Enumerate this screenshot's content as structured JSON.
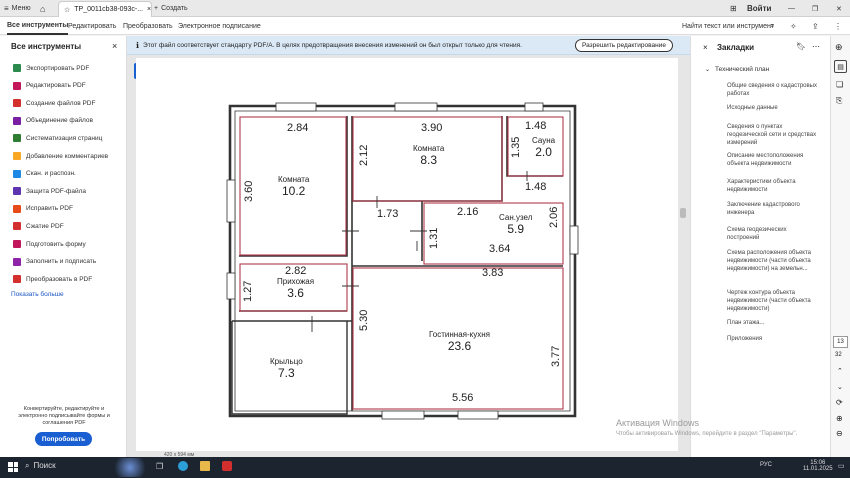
{
  "window": {
    "menu_label": "Меню",
    "tab_title": "TP_0011cb38-093c-...",
    "new_tab_label": "Создать",
    "signin_label": "Войти"
  },
  "menubar": {
    "all_tools": "Все инструменты",
    "edit": "Редактировать",
    "convert": "Преобразовать",
    "esign": "Электронное подписание",
    "search_label": "Найти текст или инструмент"
  },
  "left_panel": {
    "title": "Все инструменты",
    "tools": [
      {
        "label": "Экспортировать PDF",
        "color": "#2d8a4e"
      },
      {
        "label": "Редактировать PDF",
        "color": "#c2185b"
      },
      {
        "label": "Создание файлов PDF",
        "color": "#d32f2f"
      },
      {
        "label": "Объединение файлов",
        "color": "#7b1fa2"
      },
      {
        "label": "Систематизация страниц",
        "color": "#2e7d32"
      },
      {
        "label": "Добавление комментариев",
        "color": "#f9a825"
      },
      {
        "label": "Скан. и распозн.",
        "color": "#1e88e5"
      },
      {
        "label": "Защита PDF-файла",
        "color": "#5e35b1"
      },
      {
        "label": "Исправить PDF",
        "color": "#e64a19"
      },
      {
        "label": "Сжатие PDF",
        "color": "#d32f2f"
      },
      {
        "label": "Подготовить форму",
        "color": "#c2185b"
      },
      {
        "label": "Заполнить и подписать",
        "color": "#8e24aa"
      },
      {
        "label": "Преобразовать в PDF",
        "color": "#d32f2f"
      }
    ],
    "show_more": "Показать больше",
    "promo_text": "Конвертируйте, редактируйте и электронно подписывайте формы и соглашения PDF",
    "promo_button": "Попробовать"
  },
  "banner": {
    "text": "Этот файл соответствует стандарту PDF/A. В целях предотвращения внесения изменений он был открыт только для чтения.",
    "button": "Разрешить редактирование"
  },
  "doc": {
    "page_size": "420 x 594 мм"
  },
  "plan": {
    "rooms": [
      {
        "name": "Комната",
        "area": "10.2"
      },
      {
        "name": "Комната",
        "area": "8.3"
      },
      {
        "name": "Сауна",
        "area": "2.0"
      },
      {
        "name": "Сан.узел",
        "area": "5.9"
      },
      {
        "name": "Прихожая",
        "area": "3.6"
      },
      {
        "name": "Крыльцо",
        "area": "7.3"
      },
      {
        "name": "Гостинная-кухня",
        "area": "23.6"
      }
    ],
    "dims": [
      "2.84",
      "3.90",
      "1.48",
      "3.60",
      "2.12",
      "1.35",
      "1.48",
      "1.73",
      "2.16",
      "2.06",
      "1.31",
      "3.64",
      "3.83",
      "2.82",
      "1.27",
      "5.30",
      "3.77",
      "5.56"
    ]
  },
  "right_panel": {
    "title": "Закладки",
    "root": "Технический план",
    "bookmarks": [
      "Общие сведения о кадастровых работах",
      "Исходные данные",
      "Сведения о пунктах геодезической сети и средствах измерений",
      "Описание местоположения объекта недвижимости",
      "Характеристики объекта недвижимости",
      "Заключение кадастрового инженера",
      "Схема геодезических построений",
      "Схема расположения объекта недвижимости (части объекта недвижимости) на земельн...",
      "Чертеж контура объекта недвижимости (части объекта недвижимости)",
      "План этажа...",
      "Приложения"
    ]
  },
  "rail": {
    "page_current": "13",
    "page_total": "32"
  },
  "watermark": {
    "line1": "Активация Windows",
    "line2": "Чтобы активировать Windows, перейдите в раздел \"Параметры\"."
  },
  "taskbar": {
    "search": "Поиск",
    "lang": "РУС",
    "time": "15:06",
    "date": "11.01.2025"
  }
}
